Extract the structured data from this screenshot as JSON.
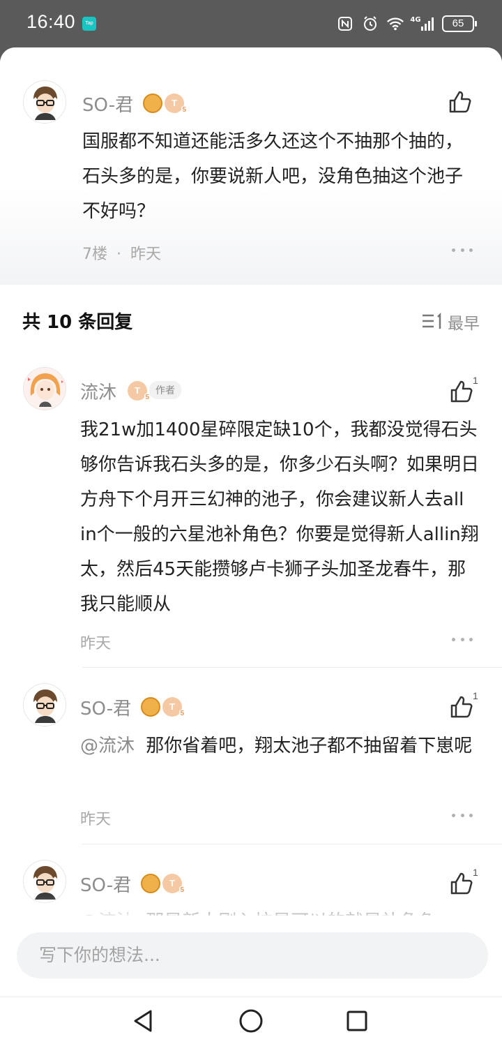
{
  "status_bar": {
    "time": "16:40",
    "app_badge": "Tap",
    "network": "4G",
    "battery": "65"
  },
  "main_comment": {
    "user": "SO-君",
    "level": "5",
    "text": "国服都不知道还能活多久还这个不抽那个抽的，石头多的是，你要说新人吧，没角色抽这个池子不好吗？",
    "floor": "7楼",
    "separator": "·",
    "time": "昨天"
  },
  "replies_header": {
    "title": "共 10 条回复",
    "sort_label": "最早"
  },
  "replies": [
    {
      "user": "流沐",
      "level": "5",
      "tag": "作者",
      "likes": "1",
      "text": "我21w加1400星碎限定缺10个，我都没觉得石头够你告诉我石头多的是，你多少石头啊？如果明日方舟下个月开三幻神的池子，你会建议新人去all in个一般的六星池补角色？你要是觉得新人allin翔太，然后45天能攒够卢卡狮子头加圣龙春牛，那我只能顺从",
      "time": "昨天"
    },
    {
      "user": "SO-君",
      "level": "5",
      "likes": "1",
      "mention": "@流沐",
      "text": "那你省着吧，翔太池子都不抽留着下崽呢",
      "time": "昨天"
    },
    {
      "user": "SO-君",
      "level": "5",
      "likes": "1",
      "mention": "@流沐",
      "text": "那是新人刚入坑是可以的就是补角色"
    }
  ],
  "composer": {
    "placeholder": "写下你的想法..."
  },
  "colors": {
    "accent_badge": "#17c6c2",
    "text_primary": "#222222",
    "text_muted": "#a8a8a8"
  }
}
